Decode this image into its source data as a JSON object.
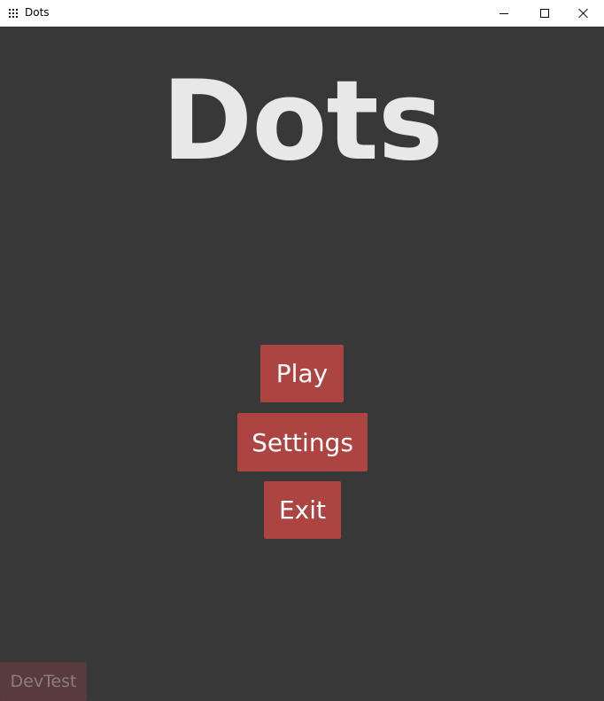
{
  "window": {
    "title": "Dots",
    "icon": "app-grid-icon",
    "controls": {
      "minimize": "minimize-icon",
      "maximize": "maximize-icon",
      "close": "close-icon"
    }
  },
  "main": {
    "title": "Dots",
    "menu": {
      "play_label": "Play",
      "settings_label": "Settings",
      "exit_label": "Exit"
    },
    "devtest_label": "DevTest"
  },
  "colors": {
    "background": "#383838",
    "title_text": "#e8e8e8",
    "button_bg": "#ac4442",
    "button_text": "#ffffff",
    "devtest_bg": "#5a3b3b",
    "devtest_text": "#8a7f7f"
  }
}
